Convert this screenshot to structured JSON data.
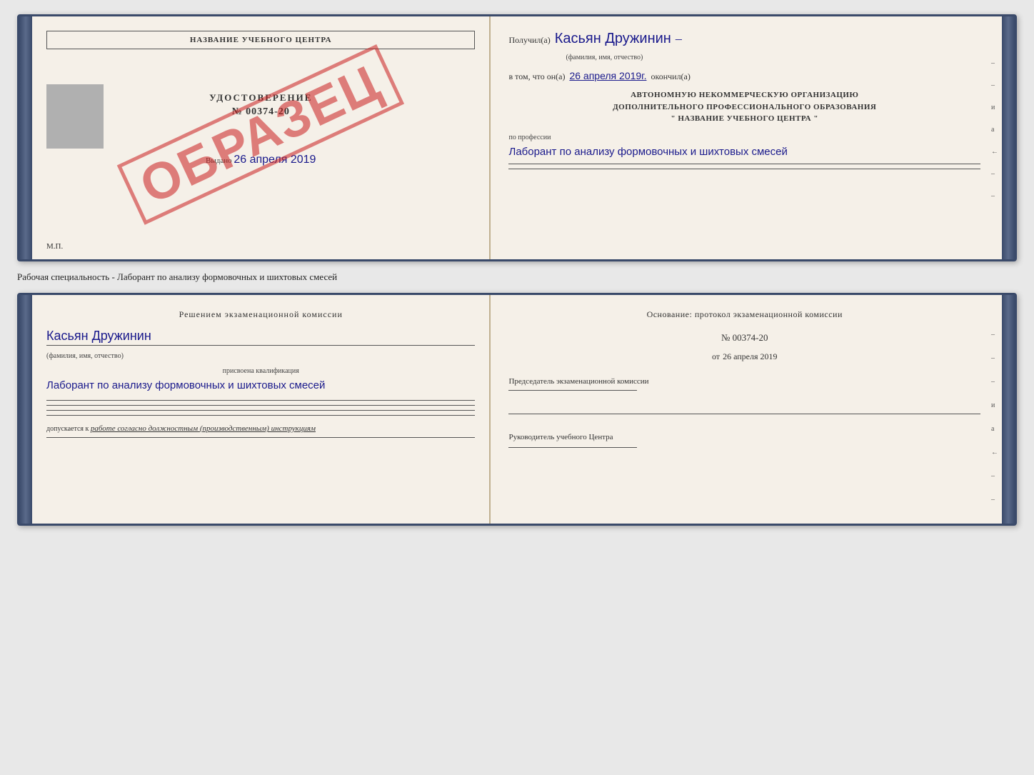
{
  "topBook": {
    "leftPage": {
      "titleBox": "НАЗВАНИЕ УЧЕБНОГО ЦЕНТРА",
      "certificateLabel": "УДОСТОВЕРЕНИЕ",
      "certificateNumber": "№ 00374-20",
      "issuedDate": "Выдано",
      "issuedDateValue": "26 апреля 2019",
      "mpLabel": "М.П.",
      "watermark": "ОБРАЗЕЦ"
    },
    "rightPage": {
      "receivedLabel": "Получил(а)",
      "recipientName": "Касьян Дружинин",
      "recipientSubtitle": "(фамилия, имя, отчество)",
      "inThatLabel": "в том, что он(а)",
      "completionDate": "26 апреля 2019г.",
      "completedLabel": "окончил(а)",
      "orgLine1": "АВТОНОМНУЮ НЕКОММЕРЧЕСКУЮ ОРГАНИЗАЦИЮ",
      "orgLine2": "ДОПОЛНИТЕЛЬНОГО ПРОФЕССИОНАЛЬНОГО ОБРАЗОВАНИЯ",
      "orgLine3": "\"   НАЗВАНИЕ УЧЕБНОГО ЦЕНТРА   \"",
      "professionLabel": "по профессии",
      "professionValue": "Лаборант по анализу формовочных и шихтовых смесей",
      "sidemarks": [
        "–",
        "–",
        "и",
        "а",
        "←",
        "–",
        "–"
      ]
    }
  },
  "separator": {
    "text": "Рабочая специальность - Лаборант по анализу формовочных и шихтовых смесей"
  },
  "bottomBook": {
    "leftPage": {
      "decisionLabel": "Решением экзаменационной комиссии",
      "personName": "Касьян Дружинин",
      "personSubtitle": "(фамилия, имя, отчество)",
      "qualificationLabel": "присвоена квалификация",
      "qualificationValue": "Лаборант по анализу формовочных и шихтовых смесей",
      "allowedLabel": "допускается к",
      "allowedValue": "работе согласно должностным (производственным) инструкциям"
    },
    "rightPage": {
      "basisLabel": "Основание: протокол экзаменационной комиссии",
      "protocolNumber": "№ 00374-20",
      "protocolDatePrefix": "от",
      "protocolDate": "26 апреля 2019",
      "chairmanLabel": "Председатель экзаменационной комиссии",
      "directorLabel": "Руководитель учебного Центра",
      "sidemarks": [
        "–",
        "–",
        "–",
        "и",
        "а",
        "←",
        "–",
        "–"
      ]
    }
  }
}
